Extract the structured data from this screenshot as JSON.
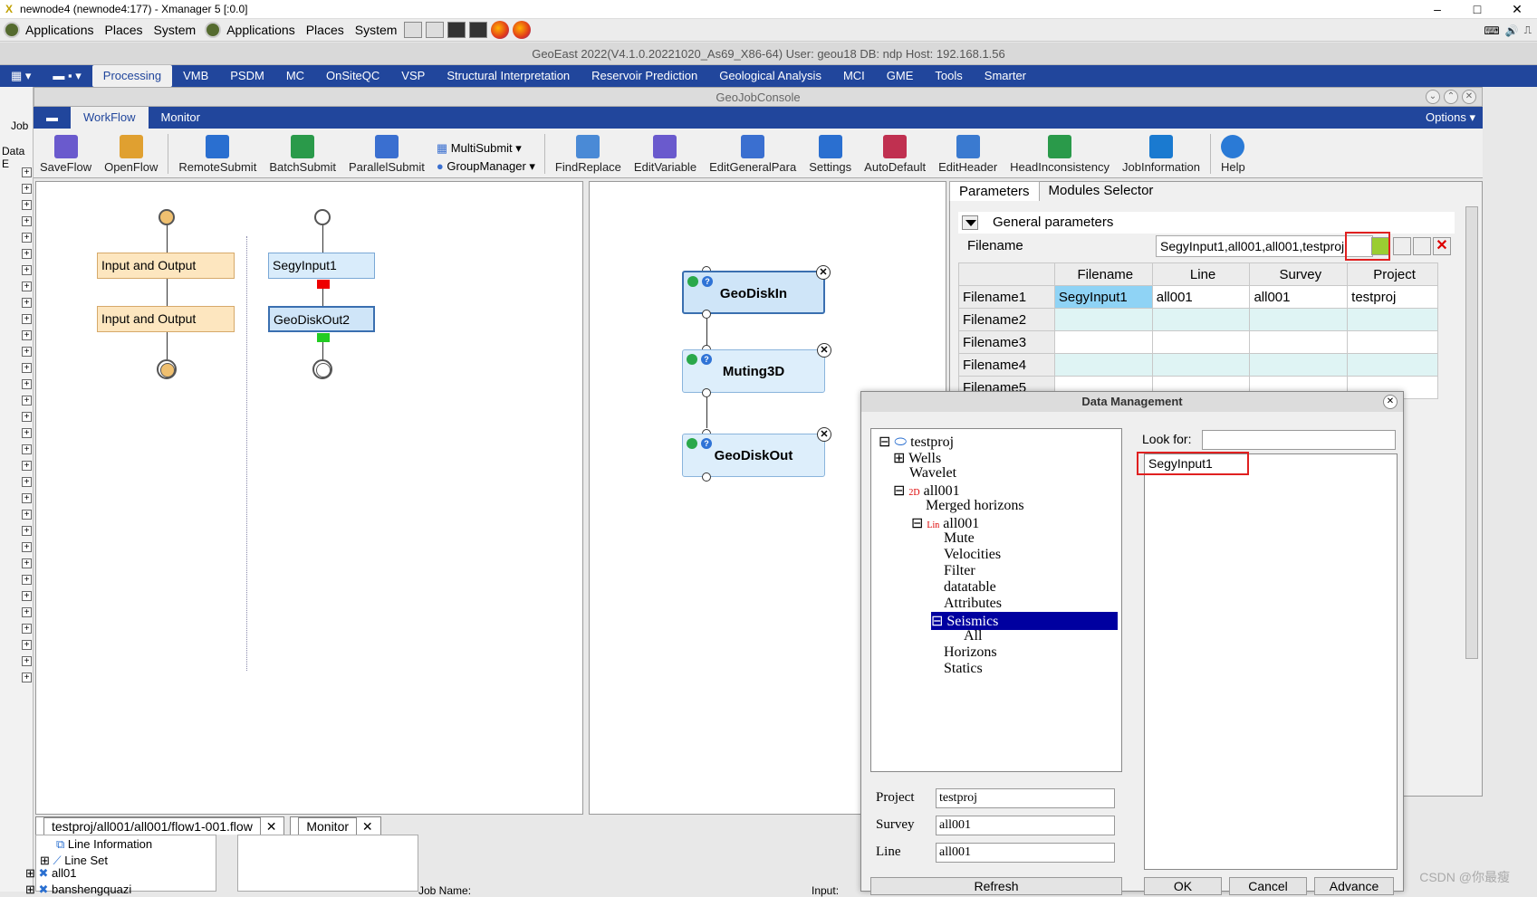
{
  "window_title": "newnode4 (newnode4:177) - Xmanager 5 [:0.0]",
  "gnome_menu": [
    "Applications",
    "Places",
    "System",
    "Applications",
    "Places",
    "System"
  ],
  "info": "GeoEast 2022(V4.1.0.20221020_As69_X86-64)   User: geou18   DB: ndp   Host: 192.168.1.56",
  "menu": [
    "Processing",
    "VMB",
    "PSDM",
    "MC",
    "OnSiteQC",
    "VSP",
    "Structural Interpretation",
    "Reservoir  Prediction",
    "Geological Analysis",
    "MCI",
    "GME",
    "Tools",
    "Smarter"
  ],
  "left_labels": {
    "job": "Job",
    "data": "Data E"
  },
  "gjc_title": "GeoJobConsole",
  "tabs": [
    "WorkFlow",
    "Monitor"
  ],
  "options": "Options",
  "toolbar": [
    {
      "label": "SaveFlow",
      "icon": "save-icon",
      "color": "#6a5acd"
    },
    {
      "label": "OpenFlow",
      "icon": "folder-open-icon",
      "color": "#e0a030"
    },
    {
      "label": "RemoteSubmit",
      "icon": "run-icon",
      "color": "#2a6fd0"
    },
    {
      "label": "BatchSubmit",
      "icon": "batch-icon",
      "color": "#2a9a4a"
    },
    {
      "label": "ParallelSubmit",
      "icon": "parallel-icon",
      "color": "#3a6fd0"
    },
    {
      "label": "FindReplace",
      "icon": "find-replace-icon",
      "color": "#4a8ad6"
    },
    {
      "label": "EditVariable",
      "icon": "edit-variable-icon",
      "color": "#6a5acd"
    },
    {
      "label": "EditGeneralPara",
      "icon": "edit-general-icon",
      "color": "#3a6fd0"
    },
    {
      "label": "Settings",
      "icon": "settings-icon",
      "color": "#2a6fd0"
    },
    {
      "label": "AutoDefault",
      "icon": "auto-default-icon",
      "color": "#c03050"
    },
    {
      "label": "EditHeader",
      "icon": "edit-header-icon",
      "color": "#3a7ad0"
    },
    {
      "label": "HeadInconsistency",
      "icon": "head-inconsistency-icon",
      "color": "#2a9a4a"
    },
    {
      "label": "JobInformation",
      "icon": "job-info-icon",
      "color": "#1a7ad0"
    },
    {
      "label": "Help",
      "icon": "help-icon",
      "color": "#2a7ad6"
    }
  ],
  "multisubmit": "MultiSubmit",
  "groupmanager": "GroupManager",
  "flow1": {
    "io1": "Input and Output",
    "io2": "Input and Output"
  },
  "flow2": {
    "n1": "SegyInput1",
    "n2": "GeoDiskOut2"
  },
  "flow3": {
    "n1": "GeoDiskIn",
    "n2": "Muting3D",
    "n3": "GeoDiskOut"
  },
  "params": {
    "tabs": [
      "Parameters",
      "Modules Selector"
    ],
    "section": "General parameters",
    "filename_label": "Filename",
    "filename_value": "SegyInput1,all001,all001,testproj",
    "headers": [
      "Filename",
      "Line",
      "Survey",
      "Project"
    ],
    "rows": [
      {
        "label": "Filename1",
        "cells": [
          "SegyInput1",
          "all001",
          "all001",
          "testproj"
        ]
      },
      {
        "label": "Filename2",
        "cells": [
          "",
          "",
          "",
          ""
        ]
      },
      {
        "label": "Filename3",
        "cells": [
          "",
          "",
          "",
          ""
        ]
      },
      {
        "label": "Filename4",
        "cells": [
          "",
          "",
          "",
          ""
        ]
      },
      {
        "label": "Filename5",
        "cells": [
          "",
          "",
          "",
          ""
        ]
      }
    ]
  },
  "dm": {
    "title": "Data Management",
    "tree": [
      "testproj",
      "Wells",
      "Wavelet",
      "all001",
      "Merged horizons",
      "all001",
      "Mute",
      "Velocities",
      "Filter",
      "datatable",
      "Attributes",
      "Seismics",
      "All",
      "Horizons",
      "Statics"
    ],
    "look_for": "Look for:",
    "look_value": "",
    "result": "SegyInput1",
    "project_label": "Project",
    "project": "testproj",
    "survey_label": "Survey",
    "survey": "all001",
    "line_label": "Line",
    "line": "all001",
    "refresh": "Refresh",
    "ok": "OK",
    "cancel": "Cancel",
    "advance": "Advance"
  },
  "bottom_tabs": [
    "testproj/all001/all001/flow1-001.flow",
    "Monitor"
  ],
  "explorer": [
    "Line Information",
    "Line Set",
    "all01",
    "banshengquazi"
  ],
  "job_name_label": "Job Name:",
  "input_label": "Input:",
  "watermark": "CSDN @你最瘦"
}
